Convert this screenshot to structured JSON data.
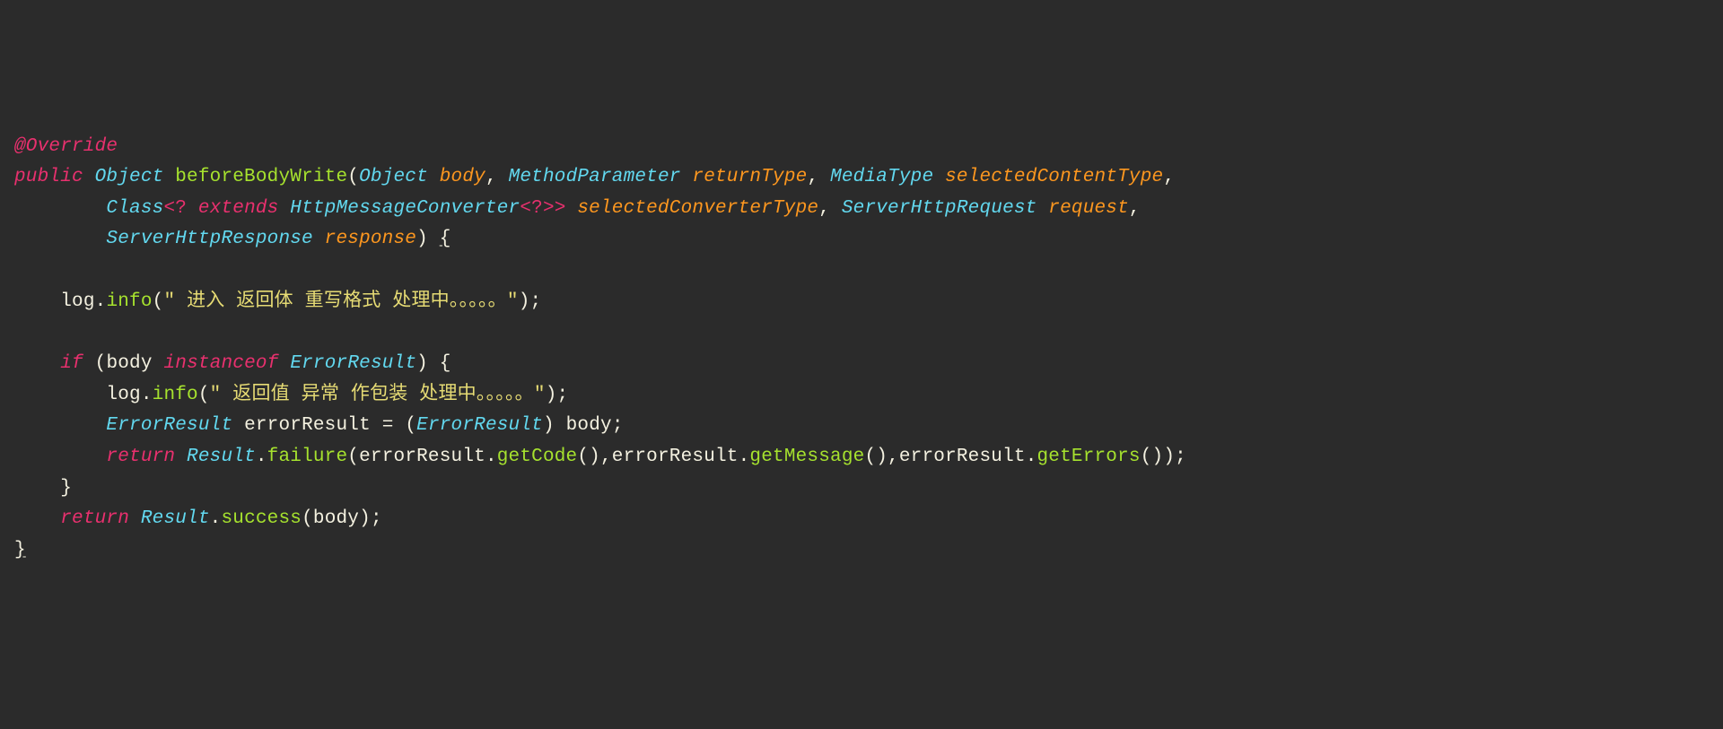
{
  "code": {
    "annotation": "@Override",
    "kw_public": "public",
    "type_object": "Object",
    "method_name": "beforeBodyWrite",
    "param_body": "body",
    "type_methodparameter": "MethodParameter",
    "param_returntype": "returnType",
    "type_mediatype": "MediaType",
    "param_selectedcontenttype": "selectedContentType",
    "type_class": "Class",
    "wildcard_open": "<?",
    "kw_extends": "extends",
    "type_httpmessageconverter": "HttpMessageConverter",
    "wildcard_inner": "<?>>",
    "param_selectedconvertertype": "selectedConverterType",
    "type_serverhttprequest": "ServerHttpRequest",
    "param_request": "request",
    "type_serverhttpresponse": "ServerHttpResponse",
    "param_response": "response",
    "log_identifier": "log",
    "info_method": "info",
    "string_log1": "\" 进入 返回体 重写格式 处理中。。。。。\"",
    "kw_if": "if",
    "body_identifier": "body",
    "kw_instanceof": "instanceof",
    "type_errorresult": "ErrorResult",
    "string_log2": "\" 返回值 异常 作包装 处理中。。。。。\"",
    "var_errorresult": "errorResult",
    "kw_return": "return",
    "type_result": "Result",
    "failure_method": "failure",
    "getcode_method": "getCode",
    "getmessage_method": "getMessage",
    "geterrors_method": "getErrors",
    "success_method": "success"
  }
}
